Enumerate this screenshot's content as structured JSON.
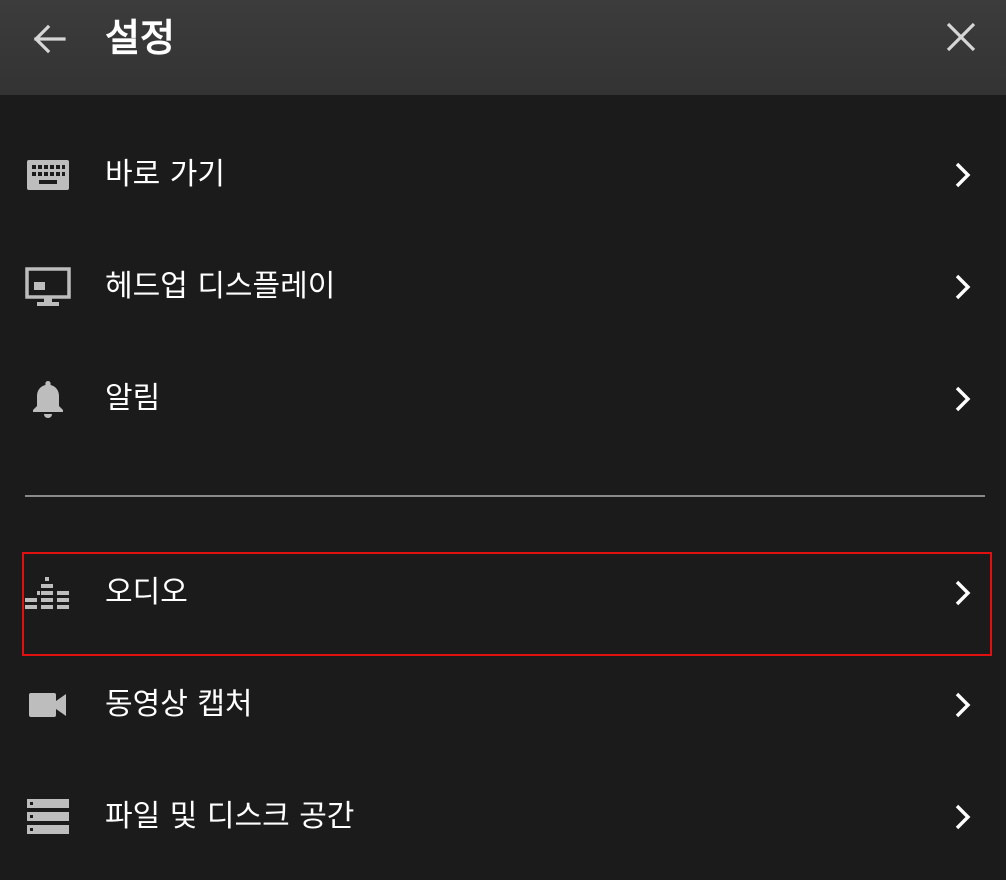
{
  "header": {
    "title": "설정",
    "back_icon": "arrow-left-icon",
    "close_icon": "close-icon"
  },
  "menu": {
    "group1": [
      {
        "label": "바로 가기",
        "icon": "keyboard-icon"
      },
      {
        "label": "헤드업 디스플레이",
        "icon": "monitor-icon"
      },
      {
        "label": "알림",
        "icon": "bell-icon"
      }
    ],
    "group2": [
      {
        "label": "오디오",
        "icon": "equalizer-icon",
        "highlighted": true
      },
      {
        "label": "동영상 캡처",
        "icon": "video-camera-icon"
      },
      {
        "label": "파일 및 디스크 공간",
        "icon": "storage-icon"
      }
    ]
  },
  "colors": {
    "background": "#1b1b1b",
    "header": "#383838",
    "divider": "#8a8a8a",
    "highlight_border": "#e01010",
    "icon": "#bdbdbd",
    "text": "#ffffff"
  }
}
